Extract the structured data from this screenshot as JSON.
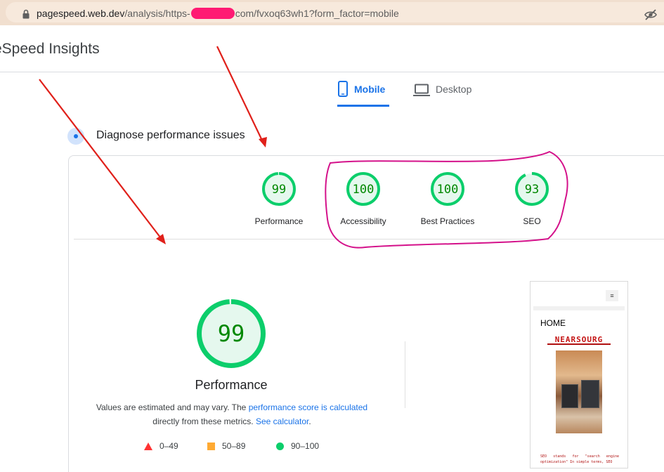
{
  "browser": {
    "url_host": "pagespeed.web.dev",
    "url_path_start": "/analysis/https-",
    "url_path_end": "com/fvxoq63wh1?form_factor=mobile"
  },
  "app": {
    "title": "eSpeed Insights"
  },
  "tabs": [
    {
      "label": "Mobile",
      "active": true
    },
    {
      "label": "Desktop",
      "active": false
    }
  ],
  "diagnose": {
    "title": "Diagnose performance issues"
  },
  "scores": [
    {
      "label": "Performance",
      "value": 99
    },
    {
      "label": "Accessibility",
      "value": 100
    },
    {
      "label": "Best Practices",
      "value": 100
    },
    {
      "label": "SEO",
      "value": 93
    }
  ],
  "performance": {
    "value": 99,
    "label": "Performance",
    "note_prefix": "Values are estimated and may vary. The",
    "note_link1": "performance score is calculated",
    "note_mid": "directly from these metrics.",
    "note_link2": "See calculator",
    "note_suffix": "."
  },
  "legend": [
    {
      "range": "0–49",
      "color": "#ff3333",
      "shape": "triangle"
    },
    {
      "range": "50–89",
      "color": "#ffaa33",
      "shape": "square"
    },
    {
      "range": "90–100",
      "color": "#0cce6b",
      "shape": "circle"
    }
  ],
  "thumbnail": {
    "menu_glyph": "≡",
    "home": "HOME",
    "logo": "NEARSOURG",
    "caption": "SEO stands for \"search engine optimization\" In simple terms, SEO"
  },
  "colors": {
    "pass": "#0cce6b",
    "pass_text": "#008800",
    "pass_fill": "#e5f8ee",
    "accent": "#1a73e8",
    "annotation_red": "#e0201a",
    "annotation_magenta": "#d4118a"
  }
}
